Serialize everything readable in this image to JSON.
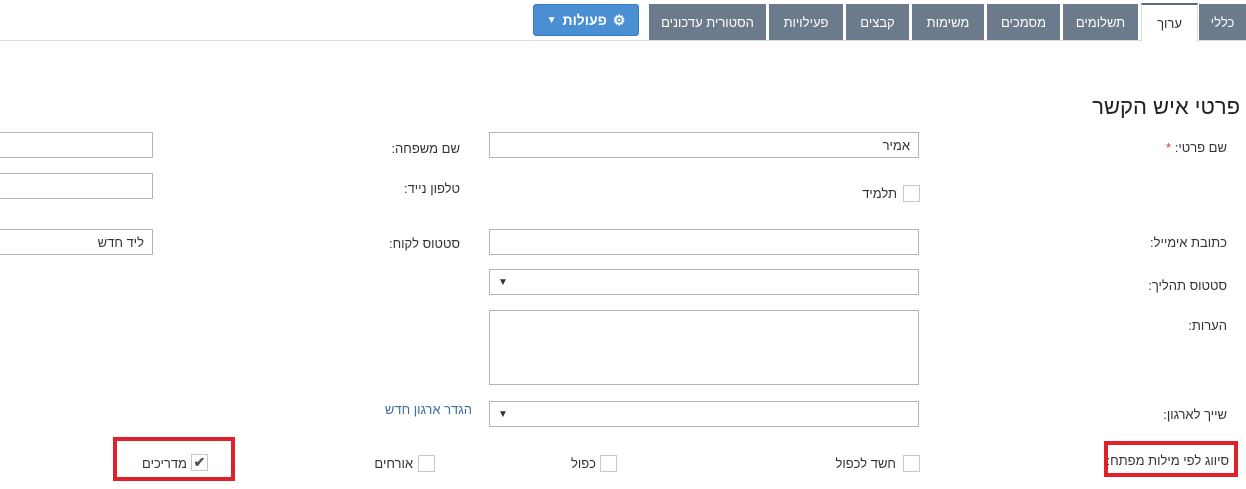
{
  "tabs": [
    "כללי",
    "ערוך",
    "תשלומים",
    "מסמכים",
    "משימות",
    "קבצים",
    "פעילויות",
    "הסטורית עדכונים"
  ],
  "active_tab": "ערוך",
  "actions_button": {
    "label": "פעולות",
    "icon": "gear-icon"
  },
  "title": "פרטי איש הקשר",
  "fields": {
    "first_name": {
      "label": "שם פרטי:",
      "required": "*",
      "value": "אמיר"
    },
    "last_name": {
      "label": "שם משפחה:",
      "value": ""
    },
    "student": {
      "label": "תלמיד",
      "checked": false
    },
    "mobile": {
      "label": "טלפון נייד:",
      "value": ""
    },
    "email": {
      "label": "כתובת אימייל:",
      "value": ""
    },
    "customer_status": {
      "label": "סטטוס לקוח:",
      "value": "ליד חדש"
    },
    "process_status": {
      "label": "סטטוס תהליך:",
      "value": ""
    },
    "notes": {
      "label": "הערות:",
      "value": ""
    },
    "organization": {
      "label": "שייך לארגון:",
      "value": "",
      "new_org_link": "הגדר ארגון חדש"
    }
  },
  "keywords": {
    "label": "סיווג לפי מילות מפתח:",
    "options": [
      {
        "label": "חשד לכפול",
        "checked": false
      },
      {
        "label": "כפול",
        "checked": false
      },
      {
        "label": "אורחים",
        "checked": false
      },
      {
        "label": "מדריכים",
        "checked": true
      }
    ]
  },
  "colors": {
    "tab": "#6b7b8c",
    "button": "#4a8ed4",
    "highlight": "#e0202a",
    "link": "#3a6ea5"
  }
}
